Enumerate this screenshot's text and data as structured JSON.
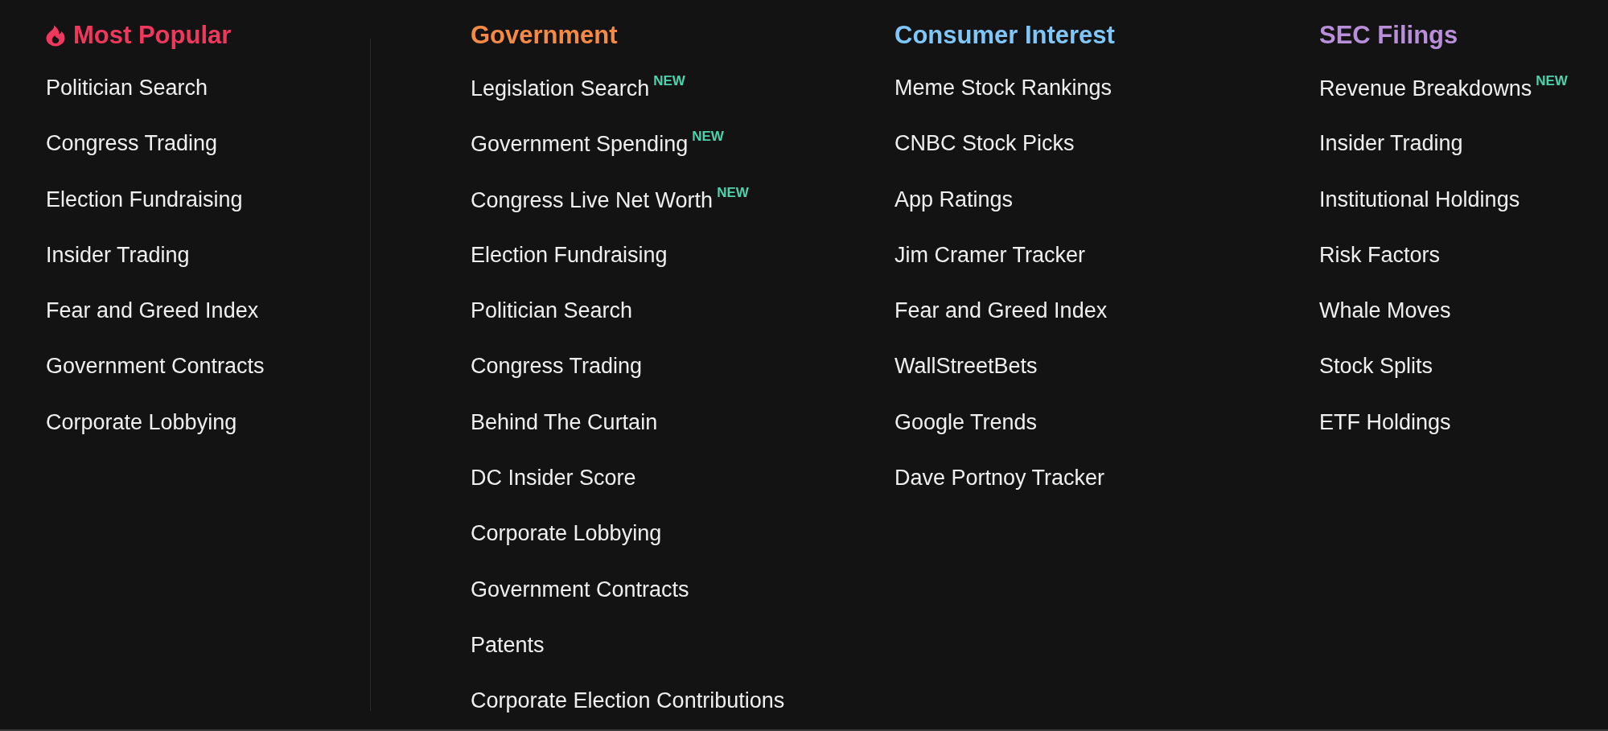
{
  "sections": [
    {
      "kind": "featured",
      "title": "Most Popular",
      "color": "#f0385e",
      "items": [
        {
          "label": "Politician Search"
        },
        {
          "label": "Congress Trading"
        },
        {
          "label": "Election Fundraising"
        },
        {
          "label": "Insider Trading"
        },
        {
          "label": "Fear and Greed Index"
        },
        {
          "label": "Government Contracts"
        },
        {
          "label": "Corporate Lobbying"
        }
      ]
    },
    {
      "kind": "category",
      "title": "Government",
      "color": "#f58a44",
      "items": [
        {
          "label": "Legislation Search",
          "badge": "NEW"
        },
        {
          "label": "Government Spending",
          "badge": "NEW"
        },
        {
          "label": "Congress Live Net Worth",
          "badge": "NEW"
        },
        {
          "label": "Election Fundraising"
        },
        {
          "label": "Politician Search"
        },
        {
          "label": "Congress Trading"
        },
        {
          "label": "Behind The Curtain"
        },
        {
          "label": "DC Insider Score"
        },
        {
          "label": "Corporate Lobbying"
        },
        {
          "label": "Government Contracts"
        },
        {
          "label": "Patents"
        },
        {
          "label": "Corporate Election Contributions"
        }
      ]
    },
    {
      "kind": "category",
      "title": "Consumer Interest",
      "color": "#80c6f8",
      "items": [
        {
          "label": "Meme Stock Rankings"
        },
        {
          "label": "CNBC Stock Picks"
        },
        {
          "label": "App Ratings"
        },
        {
          "label": "Jim Cramer Tracker"
        },
        {
          "label": "Fear and Greed Index"
        },
        {
          "label": "WallStreetBets"
        },
        {
          "label": "Google Trends"
        },
        {
          "label": "Dave Portnoy Tracker"
        }
      ]
    },
    {
      "kind": "category",
      "title": "SEC Filings",
      "color": "#b98fda",
      "items": [
        {
          "label": "Revenue Breakdowns",
          "badge": "NEW"
        },
        {
          "label": "Insider Trading"
        },
        {
          "label": "Institutional Holdings"
        },
        {
          "label": "Risk Factors"
        },
        {
          "label": "Whale Moves"
        },
        {
          "label": "Stock Splits"
        },
        {
          "label": "ETF Holdings"
        }
      ]
    }
  ]
}
